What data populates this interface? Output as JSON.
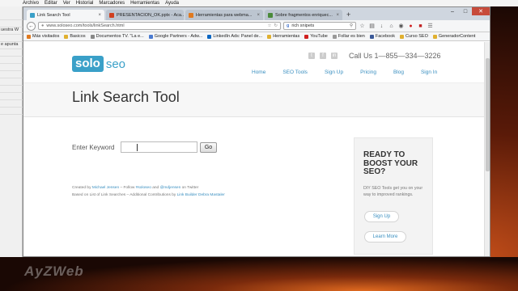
{
  "os_menubar": [
    "Archivo",
    "Editar",
    "Ver",
    "Historial",
    "Marcadores",
    "Herramientas",
    "Ayuda"
  ],
  "background_app_lines": [
    "",
    "",
    "uestra W",
    "",
    "e apunta",
    "",
    "",
    "",
    "",
    "",
    "",
    "",
    "",
    ""
  ],
  "watermark": "AyZWeb",
  "browser": {
    "tabs": [
      {
        "title": "Link Search Tool",
        "active": true,
        "favicon_color": "#3aa0c8"
      },
      {
        "title": "PRESENTACION_OK.pptx - Aca...",
        "active": false,
        "favicon_color": "#d04020"
      },
      {
        "title": "Herramientas para webma...",
        "active": false,
        "favicon_color": "#e07a20"
      },
      {
        "title": "Sobre fragmentos enriquec...",
        "active": false,
        "favicon_color": "#4a8a3a"
      }
    ],
    "new_tab_label": "+",
    "url": "www.soloseo.com/tools/linkSearch.html",
    "search_query": "rich snipets",
    "bookmarks": [
      {
        "label": "Más visitados",
        "color": "#e07a20"
      },
      {
        "label": "Basicos",
        "color": "#e0b030"
      },
      {
        "label": "Documentos TV. \"La e...",
        "color": "#888888"
      },
      {
        "label": "Google Partners - Adw...",
        "color": "#4a7ad0"
      },
      {
        "label": "LinkedIn Ads: Panel de...",
        "color": "#0a66c2"
      },
      {
        "label": "Herramientas",
        "color": "#e0b030"
      },
      {
        "label": "YouTube",
        "color": "#d02020"
      },
      {
        "label": "Follar es bien",
        "color": "#999999"
      },
      {
        "label": "Facebook",
        "color": "#3b5998"
      },
      {
        "label": "Curso SEO",
        "color": "#e0b030"
      },
      {
        "label": "GeneradorContent",
        "color": "#e0b030"
      }
    ]
  },
  "site": {
    "logo_solo": "solo",
    "logo_seo": "seo",
    "phone": "Call Us 1—855—334—3226",
    "nav": [
      "Home",
      "SEO Tools",
      "Sign Up",
      "Pricing",
      "Blog",
      "Sign In"
    ],
    "page_title": "Link Search Tool",
    "keyword_label": "Enter Keyword",
    "keyword_value": "",
    "go_label": "Go",
    "credits_line1_prefix": "Created by ",
    "credits_author": "Michael Jensen",
    "credits_line1_mid": " – Follow ",
    "credits_handle1": "#soloseo",
    "credits_and": " and ",
    "credits_handle2": "@mdjensen",
    "credits_line1_suffix": " on Twitter",
    "credits_line2_prefix": "Based on List of Link Searches – Additional Contributions by ",
    "credits_contrib": "Link Builder Debra Mastaler",
    "cta_heading": "READY TO BOOST YOUR SEO?",
    "cta_text": "DIY SEO Tools get you on your way to improved rankings.",
    "cta_signup": "Sign Up",
    "cta_learn": "Learn More"
  }
}
